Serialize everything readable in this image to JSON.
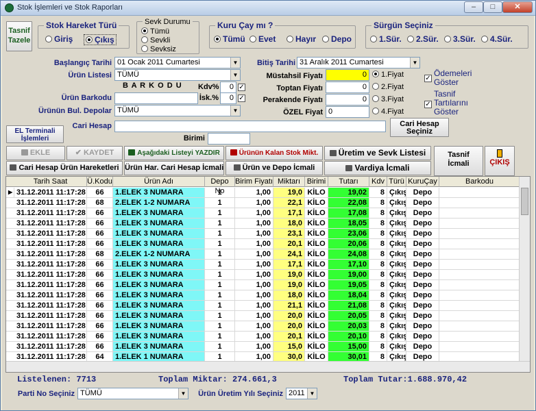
{
  "window": {
    "title": "Stok İşlemleri ve Stok Raporları"
  },
  "tasnif_tazele": "Tasnif\nTazele",
  "stok_hareket": {
    "title": "Stok Hareket Türü",
    "opt1": "Giriş",
    "opt2": "Çıkış",
    "selected": "Çıkış"
  },
  "sevk": {
    "title": "Sevk Durumu",
    "opt1": "Tümü",
    "opt2": "Sevkli",
    "opt3": "Sevksiz",
    "selected": "Tümü"
  },
  "kuru": {
    "title": "Kuru Çay mı ?",
    "opt1": "Tümü",
    "opt2": "Evet",
    "opt3": "Hayır",
    "opt4": "Depo",
    "selected": "Tümü"
  },
  "surgun": {
    "title": "Sürgün Seçiniz",
    "opt1": "1.Sür.",
    "opt2": "2.Sür.",
    "opt3": "3.Sür.",
    "opt4": "4.Sür."
  },
  "form": {
    "bas_label": "Başlangıç Tarihi",
    "bas_value": "01   Ocak   2011 Cumartesi",
    "bit_label": "Bitiş Tarihi",
    "bit_value": "31   Aralık   2011 Cumartesi",
    "urun_listesi_label": "Ürün Listesi",
    "urun_listesi_value": "TÜMÜ",
    "barkodu_header": "B A R K O D U",
    "kdv_label": "Kdv%",
    "kdv_value": "0",
    "isk_label": "İsk.%",
    "isk_value": "0",
    "urun_barkodu_label": "Ürün Barkodu",
    "depolar_label": "Ürünün Bul. Depolar",
    "depolar_value": "TÜMÜ",
    "mustahsil_label": "Müstahsil Fiyatı",
    "mustahsil_value": "0",
    "toptan_label": "Toptan Fiyatı",
    "toptan_value": "0",
    "perakende_label": "Perakende Fiyatı",
    "perakende_value": "0",
    "ozel_label": "ÖZEL Fiyat",
    "ozel_value": "0",
    "fiyat1": "1.Fiyat",
    "fiyat2": "2.Fiyat",
    "fiyat3": "3.Fiyat",
    "fiyat4": "4.Fiyat",
    "odemeleri": "Ödemeleri\nGöster",
    "tasnif_tartilarini": "Tasnif\nTartılarını\nGöster",
    "cari_label": "Cari Hesap",
    "cari_btn": "Cari Hesap\nSeçiniz",
    "birimi_label": "Birimi",
    "el_terminal": "EL Terminali\nİşlemleri"
  },
  "buttons": {
    "ekle": "EKLE",
    "kaydet": "KAYDET",
    "yazdir": "Aşağıdaki Listeyi YAZDIR",
    "kalan_stok": "Ürünün Kalan Stok Mikt.",
    "uretim_sevk": "Üretim ve Sevk Listesi",
    "tasnif_icmali": "Tasnif\nİcmali",
    "cikis": "ÇIKIŞ",
    "cari_urun": "Cari Hesap Ürün Hareketleri",
    "urun_har_cari": "Ürün Har. Cari Hesap İcmali",
    "urun_depo": "Ürün ve Depo İcmali",
    "vardiya": "Vardiya İcmali"
  },
  "table": {
    "headers": [
      "Tarih Saat",
      "Ü.Kodu",
      "Ürün Adı",
      "Depo No",
      "Birim Fiyatı",
      "Miktarı",
      "Birimi",
      "Tutarı",
      "Kdv",
      "Türü",
      "KuruÇay",
      "Barkodu"
    ],
    "rows": [
      [
        "31.12.2011 11:17:28",
        "66",
        "1.ELEK 3 NUMARA",
        "1",
        "1,00",
        "19,0",
        "KİLO",
        "19,02",
        "8",
        "Çıkış",
        "Depo",
        ""
      ],
      [
        "31.12.2011 11:17:28",
        "68",
        "2.ELEK 1-2 NUMARA",
        "1",
        "1,00",
        "22,1",
        "KİLO",
        "22,08",
        "8",
        "Çıkış",
        "Depo",
        ""
      ],
      [
        "31.12.2011 11:17:28",
        "66",
        "1.ELEK 3 NUMARA",
        "1",
        "1,00",
        "17,1",
        "KİLO",
        "17,08",
        "8",
        "Çıkış",
        "Depo",
        ""
      ],
      [
        "31.12.2011 11:17:28",
        "66",
        "1.ELEK 3 NUMARA",
        "1",
        "1,00",
        "18,0",
        "KİLO",
        "18,05",
        "8",
        "Çıkış",
        "Depo",
        ""
      ],
      [
        "31.12.2011 11:17:28",
        "66",
        "1.ELEK 3 NUMARA",
        "1",
        "1,00",
        "23,1",
        "KİLO",
        "23,06",
        "8",
        "Çıkış",
        "Depo",
        ""
      ],
      [
        "31.12.2011 11:17:28",
        "66",
        "1.ELEK 3 NUMARA",
        "1",
        "1,00",
        "20,1",
        "KİLO",
        "20,06",
        "8",
        "Çıkış",
        "Depo",
        ""
      ],
      [
        "31.12.2011 11:17:28",
        "68",
        "2.ELEK 1-2 NUMARA",
        "1",
        "1,00",
        "24,1",
        "KİLO",
        "24,08",
        "8",
        "Çıkış",
        "Depo",
        ""
      ],
      [
        "31.12.2011 11:17:28",
        "66",
        "1.ELEK 3 NUMARA",
        "1",
        "1,00",
        "17,1",
        "KİLO",
        "17,10",
        "8",
        "Çıkış",
        "Depo",
        ""
      ],
      [
        "31.12.2011 11:17:28",
        "66",
        "1.ELEK 3 NUMARA",
        "1",
        "1,00",
        "19,0",
        "KİLO",
        "19,00",
        "8",
        "Çıkış",
        "Depo",
        ""
      ],
      [
        "31.12.2011 11:17:28",
        "66",
        "1.ELEK 3 NUMARA",
        "1",
        "1,00",
        "19,0",
        "KİLO",
        "19,05",
        "8",
        "Çıkış",
        "Depo",
        ""
      ],
      [
        "31.12.2011 11:17:28",
        "66",
        "1.ELEK 3 NUMARA",
        "1",
        "1,00",
        "18,0",
        "KİLO",
        "18,04",
        "8",
        "Çıkış",
        "Depo",
        ""
      ],
      [
        "31.12.2011 11:17:28",
        "66",
        "1.ELEK 3 NUMARA",
        "1",
        "1,00",
        "21,1",
        "KİLO",
        "21,08",
        "8",
        "Çıkış",
        "Depo",
        ""
      ],
      [
        "31.12.2011 11:17:28",
        "66",
        "1.ELEK 3 NUMARA",
        "1",
        "1,00",
        "20,0",
        "KİLO",
        "20,05",
        "8",
        "Çıkış",
        "Depo",
        ""
      ],
      [
        "31.12.2011 11:17:28",
        "66",
        "1.ELEK 3 NUMARA",
        "1",
        "1,00",
        "20,0",
        "KİLO",
        "20,03",
        "8",
        "Çıkış",
        "Depo",
        ""
      ],
      [
        "31.12.2011 11:17:28",
        "66",
        "1.ELEK 3 NUMARA",
        "1",
        "1,00",
        "20,1",
        "KİLO",
        "20,10",
        "8",
        "Çıkış",
        "Depo",
        ""
      ],
      [
        "31.12.2011 11:17:28",
        "66",
        "1.ELEK 3 NUMARA",
        "1",
        "1,00",
        "15,0",
        "KİLO",
        "15,00",
        "8",
        "Çıkış",
        "Depo",
        ""
      ],
      [
        "31.12.2011 11:17:28",
        "64",
        "1.ELEK 1 NUMARA",
        "1",
        "1,00",
        "30,0",
        "KİLO",
        "30,01",
        "8",
        "Çıkış",
        "Depo",
        ""
      ]
    ]
  },
  "summary": {
    "listelenen": "Listelenen:  7713",
    "miktar": "Toplam Miktar: 274.661,3",
    "tutar": "Toplam Tutar:1.688.970,42"
  },
  "footer": {
    "parti_label": "Parti No Seçiniz",
    "parti_value": "TÜMÜ",
    "yil_label": "Ürün Üretim Yılı Seçiniz",
    "yil_value": "2011"
  },
  "colors": {
    "cyan": "#7ff7f7",
    "yellow": "#ffff80",
    "green": "#33ff33",
    "label_blue": "#1a237e",
    "alert_red": "#b00000"
  }
}
